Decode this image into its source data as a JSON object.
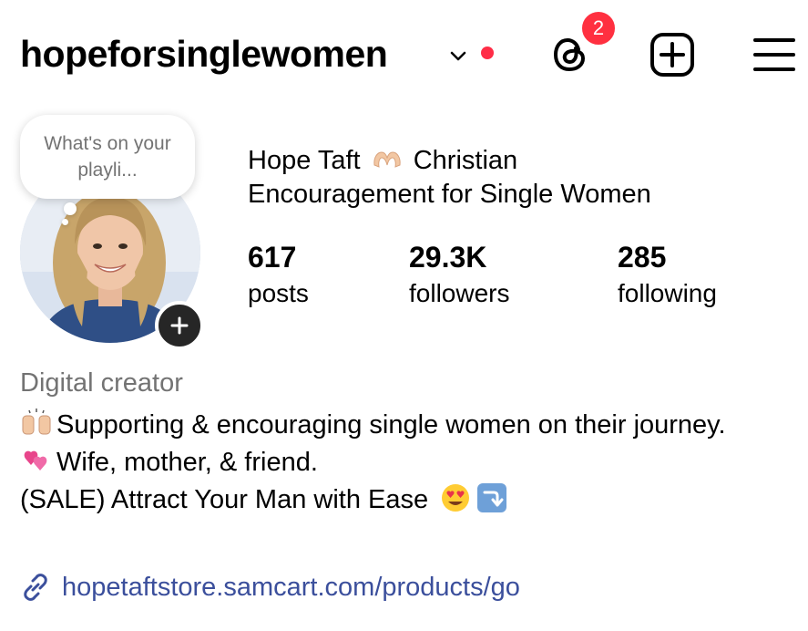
{
  "header": {
    "username": "hopeforsinglewomen",
    "threads_badge": "2",
    "icons": [
      "chevron-down-icon",
      "threads-icon",
      "new-post-icon",
      "menu-icon"
    ],
    "accent_color": "#ff3040"
  },
  "note": {
    "text": "What's on your playli..."
  },
  "profile": {
    "full_name_part1": "Hope Taft",
    "full_name_part2": "Christian",
    "full_name_line2": "Encouragement for Single Women"
  },
  "stats": [
    {
      "value": "617",
      "label": "posts"
    },
    {
      "value": "29.3K",
      "label": "followers"
    },
    {
      "value": "285",
      "label": "following"
    }
  ],
  "bio": {
    "category": "Digital creator",
    "line1": "Supporting & encouraging single women on their journey.",
    "line2": "Wife, mother, & friend.",
    "line3": "(SALE) Attract Your Man with Ease",
    "link": "hopetaftstore.samcart.com/products/go",
    "link_color": "#3b4f9c"
  }
}
